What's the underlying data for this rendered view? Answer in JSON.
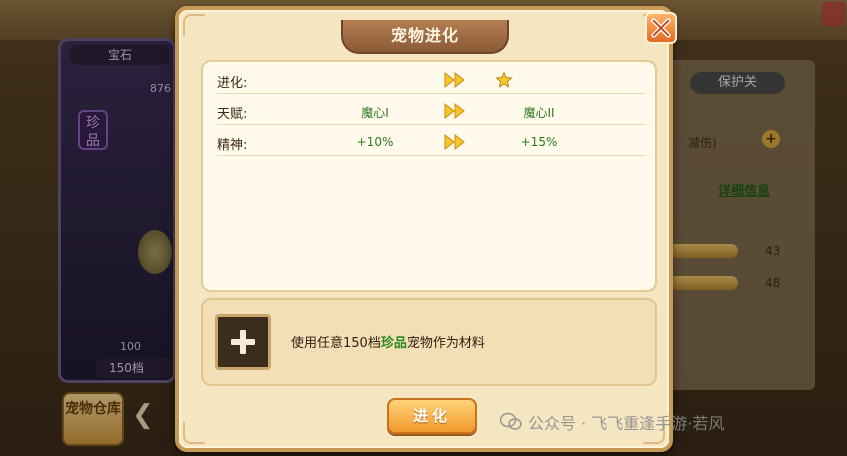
{
  "modal": {
    "title": "宠物进化",
    "close_icon": "close-icon",
    "stats": [
      {
        "label": "进化:",
        "before": "",
        "after_icon": "star-icon"
      },
      {
        "label": "天赋:",
        "before": "魔心I",
        "after": "魔心II"
      },
      {
        "label": "精神:",
        "before": "+10%",
        "after": "+15%"
      }
    ],
    "arrow_icon": "double-arrow-icon",
    "material": {
      "slot_icon": "plus-icon",
      "text_prefix": "使用任意150档",
      "text_rare": "珍品",
      "text_suffix": "宠物作为材料"
    },
    "evolve_button": "进化"
  },
  "background": {
    "left_title": "宝石",
    "left_number": "876",
    "rare_badge": "珍品",
    "left_level": "100",
    "left_bottom": "150档",
    "warehouse_button": "宠物仓库",
    "protect_toggle": "保护关",
    "hurt_label": "减伤)",
    "detail_link": "详细信息",
    "stat_value_1": "43",
    "stat_value_2": "48"
  },
  "watermark": "公众号 · 飞飞重逢手游·若风",
  "colors": {
    "accent_green": "#2b7a1e",
    "button_orange": "#f09a2a",
    "panel_cream": "#fffaeb"
  }
}
